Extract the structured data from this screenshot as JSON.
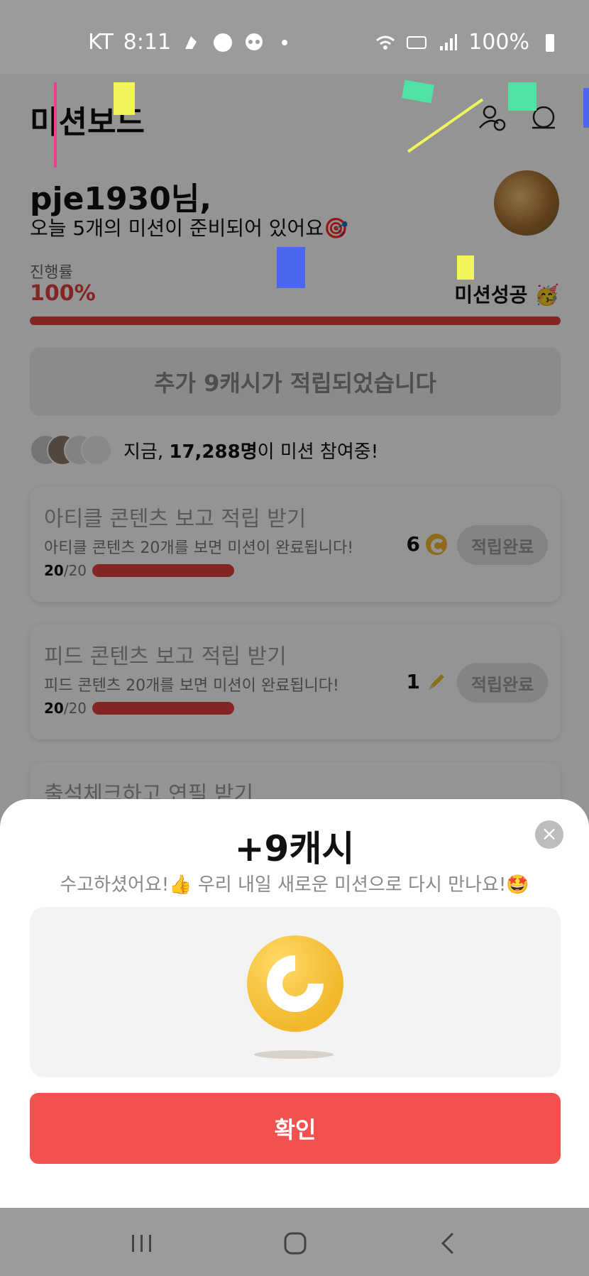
{
  "statusbar": {
    "carrier": "KT",
    "time": "8:11",
    "battery": "100%"
  },
  "header": {
    "title": "미션보드"
  },
  "greeting": {
    "name": "pje1930님,",
    "subtitle": "오늘 5개의 미션이 준비되어 있어요🎯"
  },
  "progress": {
    "label": "진행률",
    "value": "100%",
    "value_fraction": 1.0,
    "status": "미션성공 🥳"
  },
  "extra_banner": "추가 9캐시가 적립되었습니다",
  "participants": {
    "prefix": "지금, ",
    "count": "17,288명",
    "suffix": "이 미션 참여중!"
  },
  "missions": [
    {
      "title": "아티클 콘텐츠 보고 적립 받기",
      "desc": "아티클 콘텐츠 20개를 보면 미션이 완료됩니다!",
      "done": "20",
      "total": "/20",
      "reward": "6",
      "reward_icon": "coin-icon",
      "button": "적립완료"
    },
    {
      "title": "피드 콘텐츠 보고 적립 받기",
      "desc": "피드 콘텐츠 20개를 보면 미션이 완료됩니다!",
      "done": "20",
      "total": "/20",
      "reward": "1",
      "reward_icon": "pencil-icon",
      "button": "적립완료"
    },
    {
      "title": "출석체크하고 연필 받기"
    }
  ],
  "sheet": {
    "title": "+9캐시",
    "subtitle": "수고하셨어요!👍 우리 내일 새로운 미션으로 다시 만나요!🤩",
    "confirm": "확인",
    "close": "×"
  },
  "colors": {
    "accent": "#f25150",
    "progress": "#e34141",
    "coin": "#f1b82c"
  }
}
